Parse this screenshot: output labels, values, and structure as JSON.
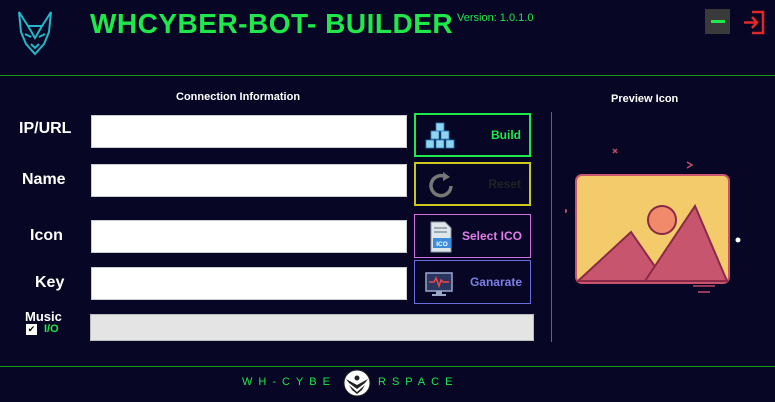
{
  "header": {
    "title": "WHCYBER-BOT- BUILDER",
    "version": "Version: 1.0.1.0",
    "logo_icon": "wolf-head-icon",
    "minimize_icon": "minimize-icon",
    "close_icon": "exit-door-icon"
  },
  "connection": {
    "section_title": "Connection Information",
    "fields": [
      {
        "label": "IP/URL",
        "value": ""
      },
      {
        "label": "Name",
        "value": ""
      },
      {
        "label": "Icon",
        "value": ""
      },
      {
        "label": "Key",
        "value": ""
      }
    ]
  },
  "actions": {
    "build": {
      "label": "Build",
      "icon": "blocks-icon",
      "color": "#1ee84a"
    },
    "reset": {
      "label": "Reset",
      "icon": "refresh-icon",
      "color": "#e8e81e"
    },
    "select_ico": {
      "label": "Select ICO",
      "icon": "ico-file-icon",
      "color": "#e07ce6"
    },
    "generate": {
      "label": "Ganarate",
      "icon": "monitor-pulse-icon",
      "color": "#7b7fe8"
    }
  },
  "music": {
    "label": "Music",
    "toggle_label": "I/O",
    "checked": true
  },
  "progress": {
    "value": 0
  },
  "preview": {
    "title": "Preview Icon",
    "icon": "image-placeholder-icon"
  },
  "footer": {
    "left_text": "WH-CYBE",
    "right_text": "RSPACE",
    "emblem_icon": "eagle-emblem-icon"
  },
  "colors": {
    "background": "#070725",
    "accent_green": "#1ee84a",
    "divider": "#1a9b1a"
  }
}
